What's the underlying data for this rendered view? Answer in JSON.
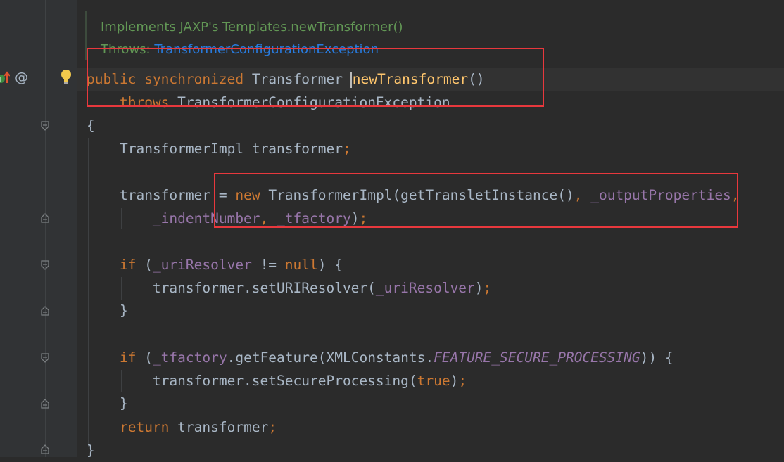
{
  "javadoc": {
    "implements_text": "Implements JAXP's Templates.newTransformer()",
    "throws_label": "Throws: ",
    "throws_link": "TransformerConfigurationException"
  },
  "gutter": {
    "override_icon": "implementing-method-icon",
    "at_symbol": "@",
    "bulb_icon": "intention-bulb-icon"
  },
  "code": {
    "l1": {
      "kw_public": "public",
      "kw_sync": "synchronized",
      "type": "Transformer",
      "method": "newTransformer",
      "parens": "()"
    },
    "l2": {
      "kw_throws": "throws",
      "type": "TransformerConfigurationException"
    },
    "l3": {
      "brace": "{"
    },
    "l4": {
      "type": "TransformerImpl",
      "var": "transformer",
      "semi": ";"
    },
    "l5": {
      "var": "transformer",
      "eq": " = ",
      "kw_new": "new",
      "type": "TransformerImpl(getTransletInstance()",
      "comma": ",",
      "field": "_outputProperties",
      "comma2": ","
    },
    "l6": {
      "field1": "_indentNumber",
      "comma": ",",
      "field2": "_tfactory",
      "close": ")",
      "semi": ";"
    },
    "l7": {
      "kw_if": "if",
      "open": " (",
      "field": "_uriResolver",
      "op": " != ",
      "kw_null": "null",
      "close": ") {"
    },
    "l8": {
      "call": "transformer.setURIResolver(",
      "field": "_uriResolver",
      "close": ")",
      "semi": ";"
    },
    "l9": {
      "brace": "}"
    },
    "l10": {
      "kw_if": "if",
      "open": " (",
      "field": "_tfactory",
      "call": ".getFeature(XMLConstants.",
      "constant": "FEATURE_SECURE_PROCESSING",
      "close": ")) {"
    },
    "l11": {
      "call": "transformer.setSecureProcessing(",
      "kw_true": "true",
      "close": ")",
      "semi": ";"
    },
    "l12": {
      "brace": "}"
    },
    "l13": {
      "kw_return": "return",
      "var": "transformer",
      "semi": ";"
    },
    "l14": {
      "brace": "}"
    }
  },
  "colors": {
    "background": "#2b2b2b",
    "keyword": "#cc7832",
    "method": "#ffc66d",
    "field": "#9876aa",
    "doc": "#629755",
    "highlight_box": "#e8383d"
  }
}
